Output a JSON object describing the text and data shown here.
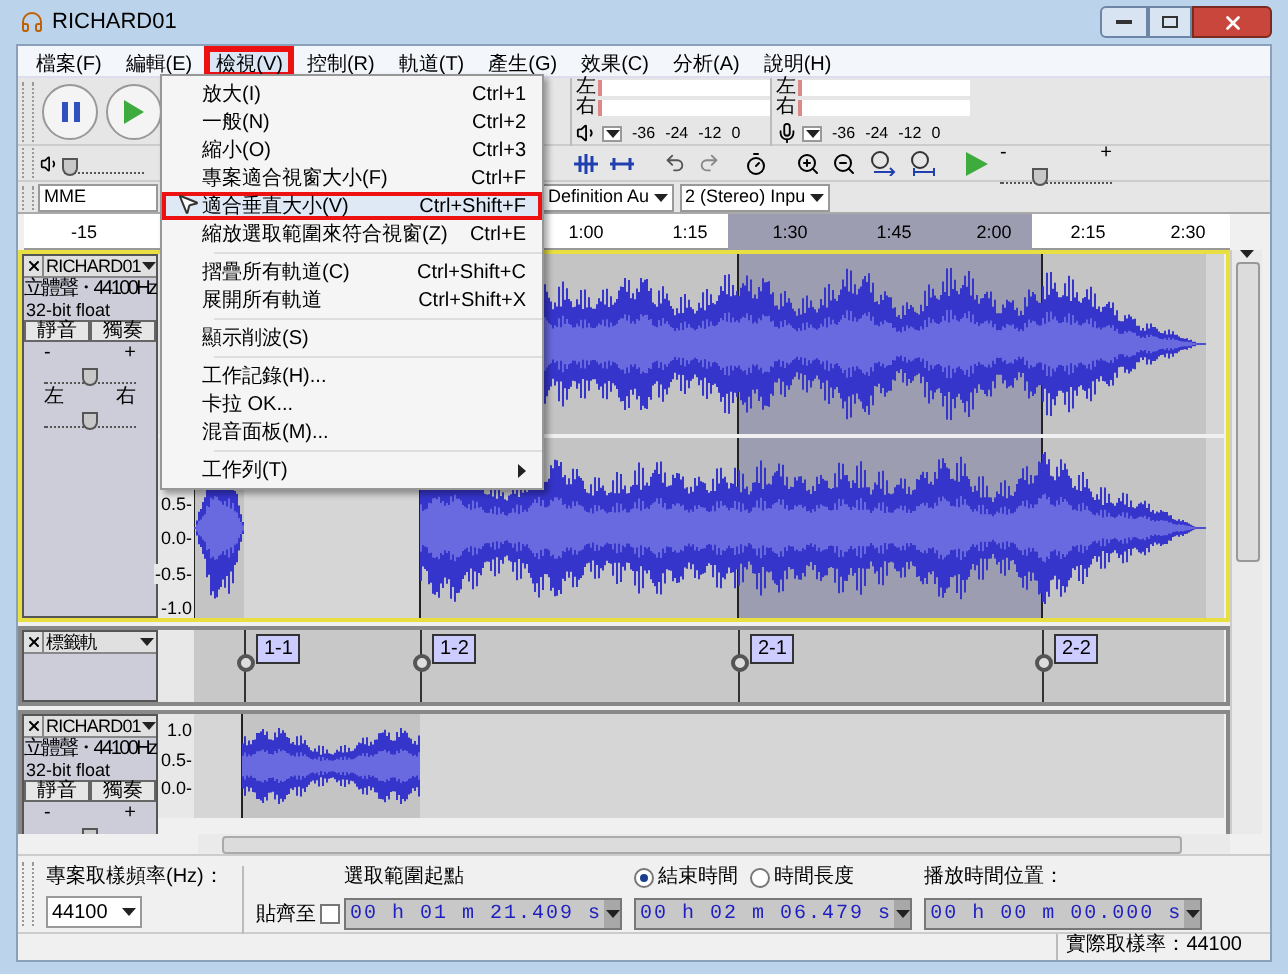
{
  "window": {
    "title": "RICHARD01"
  },
  "menu_bar": [
    {
      "label": "檔案(F)",
      "selected": false,
      "annotated": false
    },
    {
      "label": "編輯(E)",
      "selected": false,
      "annotated": false
    },
    {
      "label": "檢視(V)",
      "selected": true,
      "annotated": true
    },
    {
      "label": "控制(R)",
      "selected": false,
      "annotated": false
    },
    {
      "label": "軌道(T)",
      "selected": false,
      "annotated": false
    },
    {
      "label": "產生(G)",
      "selected": false,
      "annotated": false
    },
    {
      "label": "效果(C)",
      "selected": false,
      "annotated": false
    },
    {
      "label": "分析(A)",
      "selected": false,
      "annotated": false
    },
    {
      "label": "說明(H)",
      "selected": false,
      "annotated": false
    }
  ],
  "view_menu": {
    "items": [
      {
        "kind": "item",
        "label": "放大(I)",
        "shortcut": "Ctrl+1",
        "selected": false,
        "annotated": false
      },
      {
        "kind": "item",
        "label": "一般(N)",
        "shortcut": "Ctrl+2",
        "selected": false,
        "annotated": false
      },
      {
        "kind": "item",
        "label": "縮小(O)",
        "shortcut": "Ctrl+3",
        "selected": false,
        "annotated": false
      },
      {
        "kind": "item",
        "label": "專案適合視窗大小(F)",
        "shortcut": "Ctrl+F",
        "selected": false,
        "annotated": false
      },
      {
        "kind": "item",
        "label": "適合垂直大小(V)",
        "shortcut": "Ctrl+Shift+F",
        "selected": true,
        "annotated": true
      },
      {
        "kind": "item",
        "label": "縮放選取範圍來符合視窗(Z)",
        "shortcut": "Ctrl+E",
        "selected": false,
        "annotated": false
      },
      {
        "kind": "separator"
      },
      {
        "kind": "item",
        "label": "摺疊所有軌道(C)",
        "shortcut": "Ctrl+Shift+C",
        "selected": false,
        "annotated": false
      },
      {
        "kind": "item",
        "label": "展開所有軌道",
        "shortcut": "Ctrl+Shift+X",
        "selected": false,
        "annotated": false
      },
      {
        "kind": "separator"
      },
      {
        "kind": "item",
        "label": "顯示削波(S)",
        "selected": false,
        "annotated": false
      },
      {
        "kind": "separator"
      },
      {
        "kind": "item",
        "label": "工作記錄(H)...",
        "selected": false,
        "annotated": false
      },
      {
        "kind": "item",
        "label": "卡拉 OK...",
        "selected": false,
        "annotated": false
      },
      {
        "kind": "item",
        "label": "混音面板(M)...",
        "selected": false,
        "annotated": false
      },
      {
        "kind": "separator"
      },
      {
        "kind": "submenu",
        "label": "工作列(T)",
        "selected": false,
        "annotated": false
      }
    ]
  },
  "output_volume": {
    "level": 0.08
  },
  "meters": [
    {
      "kind": "playback",
      "channels": [
        "左",
        "右"
      ],
      "scale": [
        "-36",
        "-24",
        "-12",
        "0"
      ]
    },
    {
      "kind": "recording",
      "channels": [
        "左",
        "右"
      ],
      "scale": [
        "-36",
        "-24",
        "-12",
        "0"
      ]
    }
  ],
  "play_speed": {
    "level": 0.35,
    "min_label": "-",
    "max_label": "+"
  },
  "device_toolbar": {
    "host": "MME",
    "output_device": "Definition Au",
    "input_channels": "2 (Stereo) Inpu"
  },
  "ruler": {
    "ticks": [
      "-15",
      "1:00",
      "1:15",
      "1:30",
      "1:45",
      "2:00",
      "2:15",
      "2:30"
    ]
  },
  "tracks": [
    {
      "kind": "audio",
      "both_channels_shown": true,
      "name": "RICHARD01",
      "format": "立體聲・44100Hz",
      "bit_depth": "32-bit float",
      "mute": "靜音",
      "solo": "獨奏",
      "selected": true,
      "gain": {
        "min_label": "-",
        "max_label": "+",
        "level": 0.5
      },
      "pan": {
        "min_label": "左",
        "max_label": "右",
        "level": 0.5
      },
      "scale": [
        "0.5-",
        "0.0-",
        "-0.5-",
        "-1.0"
      ]
    },
    {
      "kind": "label",
      "name": "標籤軌",
      "labels": [
        "1-1",
        "1-2",
        "2-1",
        "2-2"
      ]
    },
    {
      "kind": "audio",
      "both_channels_shown": false,
      "name": "RICHARD01",
      "format": "立體聲・44100Hz",
      "bit_depth": "32-bit float",
      "mute": "靜音",
      "solo": "獨奏",
      "selected": false,
      "gain": {
        "min_label": "-",
        "max_label": "+",
        "level": 0.5
      },
      "scale": [
        "1.0",
        "0.5-",
        "0.0-"
      ]
    }
  ],
  "selection_bar": {
    "rate_label": "專案取樣頻率(Hz)：",
    "rate": "44100",
    "start_label": "選取範圍起點",
    "snap_label": "貼齊至",
    "snap_checked": false,
    "start_time": "00 h 01 m 21.409 s",
    "modes": [
      {
        "label": "結束時間",
        "selected": true
      },
      {
        "label": "時間長度",
        "selected": false
      }
    ],
    "end_time": "00 h 02 m 06.479 s",
    "position_label": "播放時間位置：",
    "position_time": "00 h 00 m 00.000 s"
  },
  "status_bar": {
    "text": "實際取樣率：44100"
  }
}
